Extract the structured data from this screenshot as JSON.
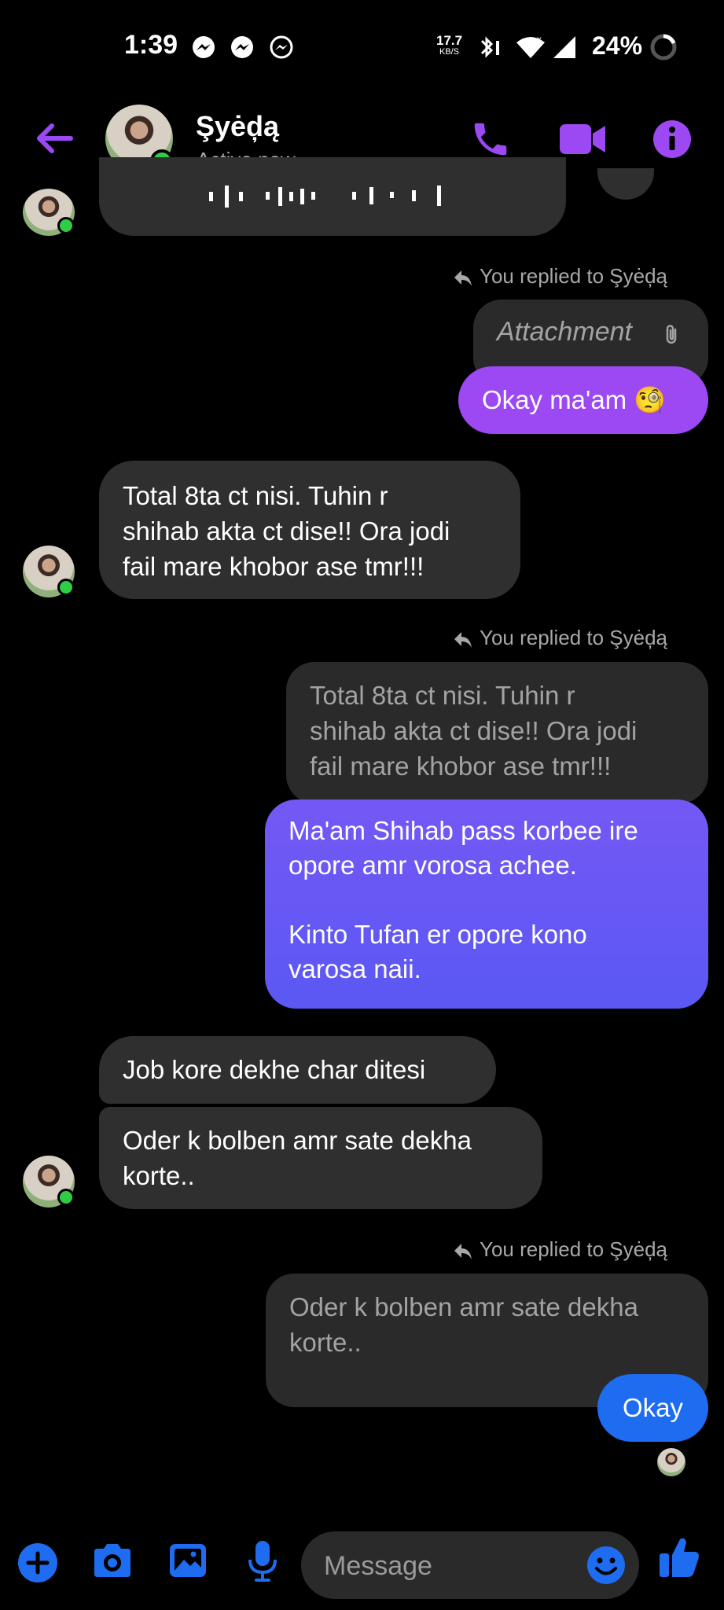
{
  "status_bar": {
    "time": "1:39",
    "net_speed_value": "17.7",
    "net_speed_unit": "KB/S",
    "battery": "24%"
  },
  "header": {
    "contact_name": "Şyėḑą",
    "contact_status": "Active now",
    "accent": "#9c48f3"
  },
  "messages": {
    "reply_label_1": "You replied to Şyėḑą",
    "quote_attachment": "Attachment",
    "sent_1": "Okay ma'am 🧐",
    "received_1_lines": [
      "Total 8ta ct nisi. Tuhin r",
      "shihab akta ct dise!! Ora jodi",
      "fail mare khobor ase tmr!!!"
    ],
    "reply_label_2": "You replied to Şyėḑą",
    "quote_2_lines": [
      "Total 8ta ct nisi. Tuhin r",
      "shihab akta ct dise!! Ora jodi",
      "fail mare khobor ase tmr!!!"
    ],
    "sent_2_lines": [
      "Ma'am Shihab pass korbee ire",
      "opore amr vorosa achee.",
      "",
      "Kinto Tufan er opore kono",
      "varosa naii."
    ],
    "received_2": "Job kore dekhe char ditesi",
    "received_3_lines": [
      "Oder k bolben amr sate dekha",
      "korte.."
    ],
    "reply_label_3": "You replied to Şyėḑą",
    "quote_3_lines": [
      "Oder k bolben amr sate dekha",
      "korte.."
    ],
    "sent_3": "Okay"
  },
  "composer": {
    "placeholder": "Message"
  },
  "colors": {
    "background": "#000000",
    "incoming_bubble": "#2f2f30",
    "quote_bubble": "#2a2a2b",
    "outgoing_purple": "#9c48f3",
    "outgoing_violet": "#6a58f4",
    "outgoing_blue": "#1e6cf0",
    "toolbar_icons": "#1e6cf0",
    "online_dot": "#31cc46"
  },
  "icons": [
    "messenger-icon",
    "back-arrow-icon",
    "phone-icon",
    "video-icon",
    "info-icon",
    "reply-icon",
    "paperclip-icon",
    "plus-icon",
    "camera-icon",
    "gallery-icon",
    "mic-icon",
    "emoji-icon",
    "thumbs-up-icon"
  ]
}
